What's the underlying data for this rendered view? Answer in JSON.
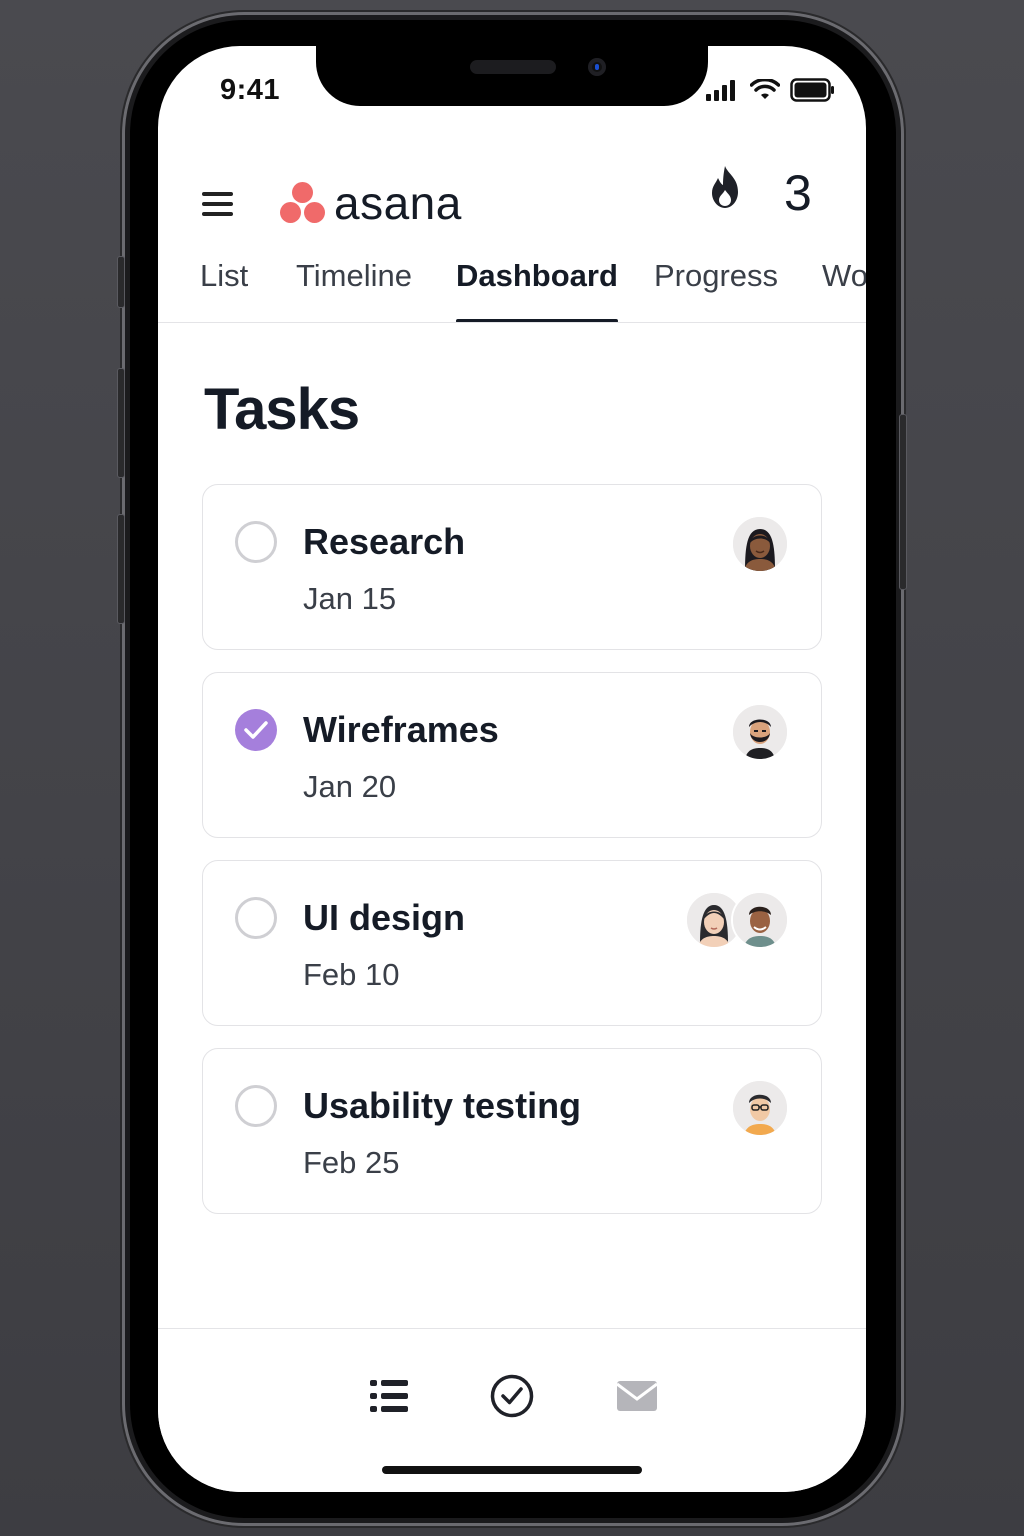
{
  "status_bar": {
    "time": "9:41"
  },
  "header": {
    "app_name": "asana",
    "streak_count": "3",
    "brand_color": "#f06a6a"
  },
  "tabs": [
    {
      "label": "List"
    },
    {
      "label": "Timeline"
    },
    {
      "label": "Dashboard",
      "active": true
    },
    {
      "label": "Progress"
    },
    {
      "label": "Wo"
    }
  ],
  "page": {
    "title": "Tasks"
  },
  "tasks": [
    {
      "name": "Research",
      "date": "Jan 15",
      "completed": false,
      "assignees": [
        "avatar-woman-dark-hair"
      ]
    },
    {
      "name": "Wireframes",
      "date": "Jan 20",
      "completed": true,
      "assignees": [
        "avatar-man-beard"
      ]
    },
    {
      "name": "UI design",
      "date": "Feb 10",
      "completed": false,
      "assignees": [
        "avatar-woman-light",
        "avatar-man-dark"
      ]
    },
    {
      "name": "Usability testing",
      "date": "Feb 25",
      "completed": false,
      "assignees": [
        "avatar-man-glasses"
      ]
    }
  ],
  "bottom_nav": [
    {
      "icon": "list-icon"
    },
    {
      "icon": "check-circle-icon"
    },
    {
      "icon": "mail-icon"
    }
  ],
  "colors": {
    "check_done": "#a57fdc",
    "text_primary": "#151b26"
  }
}
